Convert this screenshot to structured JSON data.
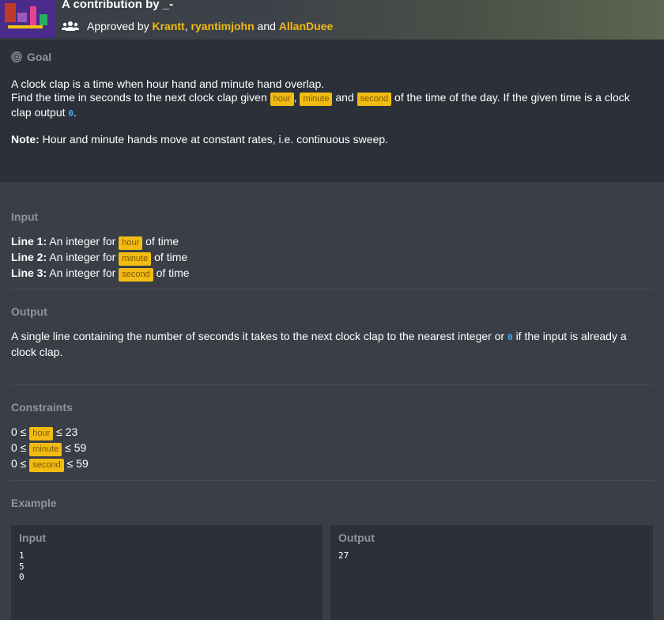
{
  "header": {
    "title": "A contribution by _-",
    "approved_prefix": "Approved by",
    "approvers": [
      "Krantt",
      "ryantimjohn",
      "AllanDuee"
    ],
    "sep_comma": ",",
    "sep_and": "and"
  },
  "goal": {
    "title": "Goal",
    "line1": "A clock clap is a time when hour hand and minute hand overlap.",
    "line2_a": "Find the time in seconds to the next clock clap given",
    "tag_hour": "hour",
    "tag_minute": "minute",
    "tag_second": "second",
    "comma": ",",
    "and": "and",
    "line2_b": "of the time of the day. If the given time is a clock clap output",
    "zero": "0",
    "period": ".",
    "note_label": "Note:",
    "note_text": "Hour and minute hands move at constant rates, i.e. continuous sweep."
  },
  "input": {
    "title": "Input",
    "lines": [
      {
        "label": "Line 1:",
        "pre": "An integer for",
        "tag": "hour",
        "post": "of time"
      },
      {
        "label": "Line 2:",
        "pre": "An integer for",
        "tag": "minute",
        "post": "of time"
      },
      {
        "label": "Line 3:",
        "pre": "An integer for",
        "tag": "second",
        "post": "of time"
      }
    ]
  },
  "output": {
    "title": "Output",
    "text_a": "A single line containing the number of seconds it takes to the next clock clap to the nearest integer or",
    "zero": "0",
    "text_b": "if the input is already a clock clap."
  },
  "constraints": {
    "title": "Constraints",
    "rows": [
      {
        "pre": "0 ≤",
        "tag": "hour",
        "post": "≤ 23"
      },
      {
        "pre": "0 ≤",
        "tag": "minute",
        "post": "≤ 59"
      },
      {
        "pre": "0 ≤",
        "tag": "second",
        "post": "≤ 59"
      }
    ]
  },
  "example": {
    "title": "Example",
    "input_title": "Input",
    "input_content": "1\n5\n0",
    "output_title": "Output",
    "output_content": "27"
  },
  "colors": {
    "accent": "#f2bb13",
    "zero": "#3fa9f5",
    "panel": "#2c3038",
    "background": "#3a3f47"
  }
}
